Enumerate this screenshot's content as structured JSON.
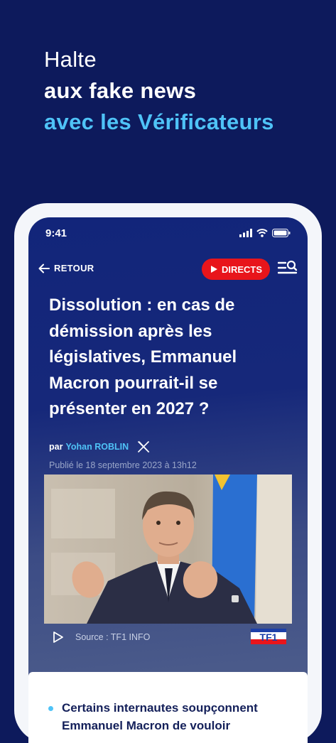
{
  "promo": {
    "line1": "Halte",
    "line2": "aux fake news",
    "line3": "avec les Vérificateurs"
  },
  "status_bar": {
    "time": "9:41"
  },
  "nav": {
    "back_label": "RETOUR",
    "directs_label": "DIRECTS"
  },
  "article": {
    "headline": "Dissolution : en cas de démission après les législatives, Emmanuel Macron pourrait-il se présenter en 2027 ?",
    "by_prefix": "par",
    "author": "Yohan ROBLIN",
    "published": "Publié le 18 septembre 2023 à 13h12",
    "source": "Source : TF1 INFO",
    "source_logo_text": "TF1",
    "bullet_text": "Certains internautes soupçonnent Emmanuel Macron de vouloir"
  },
  "colors": {
    "background": "#0d1a5c",
    "accent_blue": "#4fc3f7",
    "live_red": "#e8151b"
  },
  "icons": [
    "back-arrow-icon",
    "play-icon",
    "menu-search-icon",
    "x-logo-icon",
    "video-play-icon",
    "signal-icon",
    "wifi-icon",
    "battery-icon"
  ]
}
